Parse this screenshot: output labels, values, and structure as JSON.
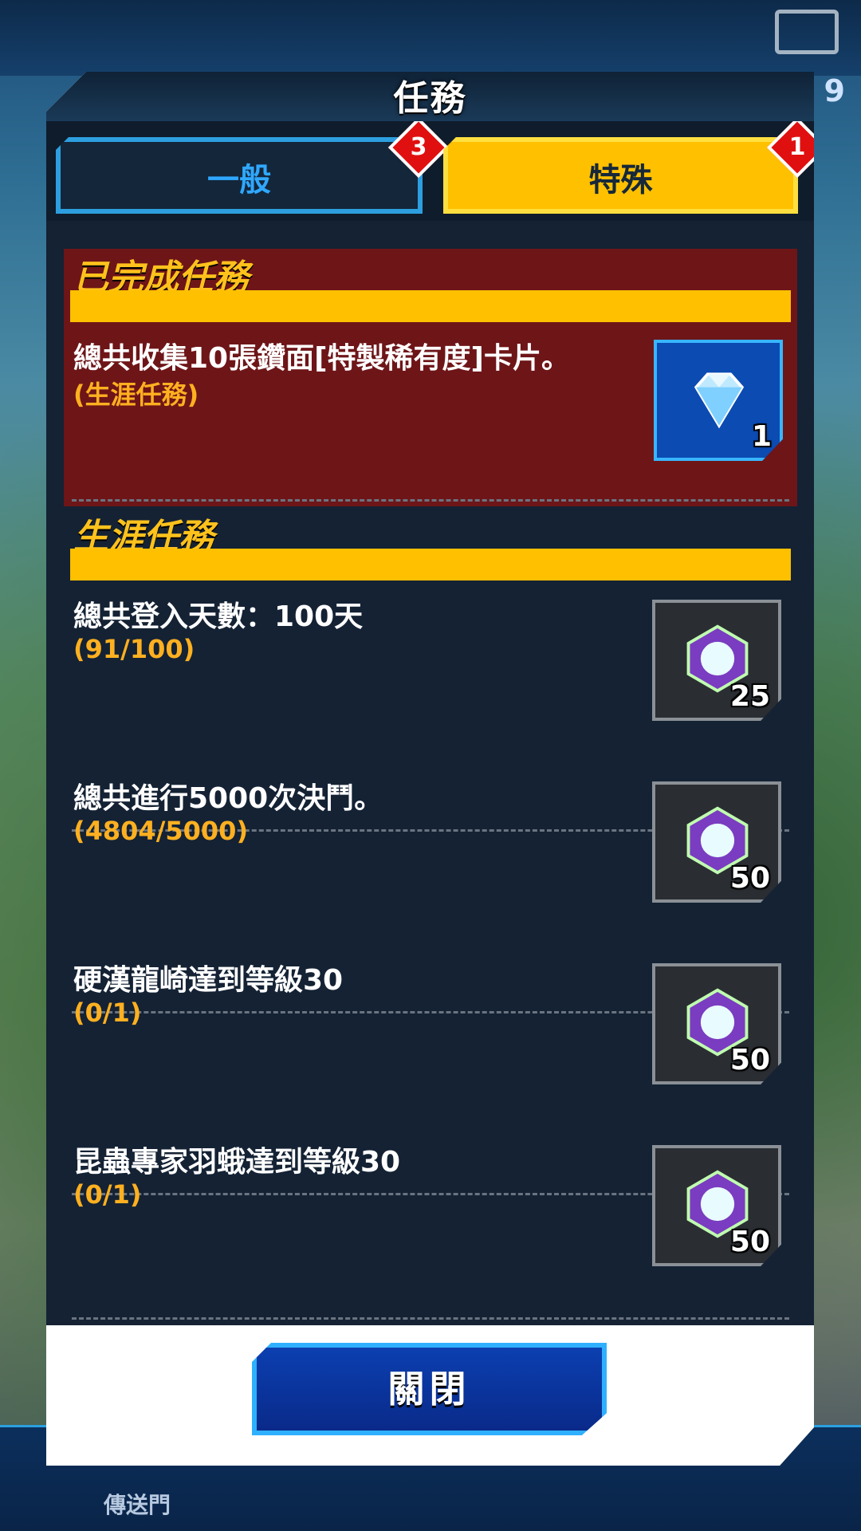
{
  "dialog": {
    "title": "任務",
    "tabs": [
      {
        "label": "一般",
        "badge": "3",
        "active": false
      },
      {
        "label": "特殊",
        "badge": "1",
        "active": true
      }
    ],
    "sections": {
      "completed": {
        "header": "已完成任務",
        "quests": [
          {
            "title": "總共收集10張鑽面[特製稀有度]卡片。",
            "progress": "(生涯任務)",
            "reward_icon": "diamond-card-icon",
            "reward_count": "1"
          }
        ]
      },
      "career": {
        "header": "生涯任務",
        "quests": [
          {
            "title": "總共登入天數：100天",
            "progress": "(91/100)",
            "reward_icon": "gem-icon",
            "reward_count": "25"
          },
          {
            "title": "總共進行5000次決鬥。",
            "progress": "(4804/5000)",
            "reward_icon": "gem-icon",
            "reward_count": "50"
          },
          {
            "title": "硬漢龍崎達到等級30",
            "progress": "(0/1)",
            "reward_icon": "gem-icon",
            "reward_count": "50"
          },
          {
            "title": "昆蟲專家羽蛾達到等級30",
            "progress": "(0/1)",
            "reward_icon": "gem-icon",
            "reward_count": "50"
          }
        ]
      }
    },
    "close_label": "關閉"
  },
  "background": {
    "level_text": "9",
    "nav_label": "傳送門"
  },
  "colors": {
    "accent_yellow": "#ffc000",
    "panel_dark": "#142234",
    "completed_bg": "#6e1518",
    "tab_blue": "#2fa8ff",
    "badge_red": "#e01010"
  }
}
